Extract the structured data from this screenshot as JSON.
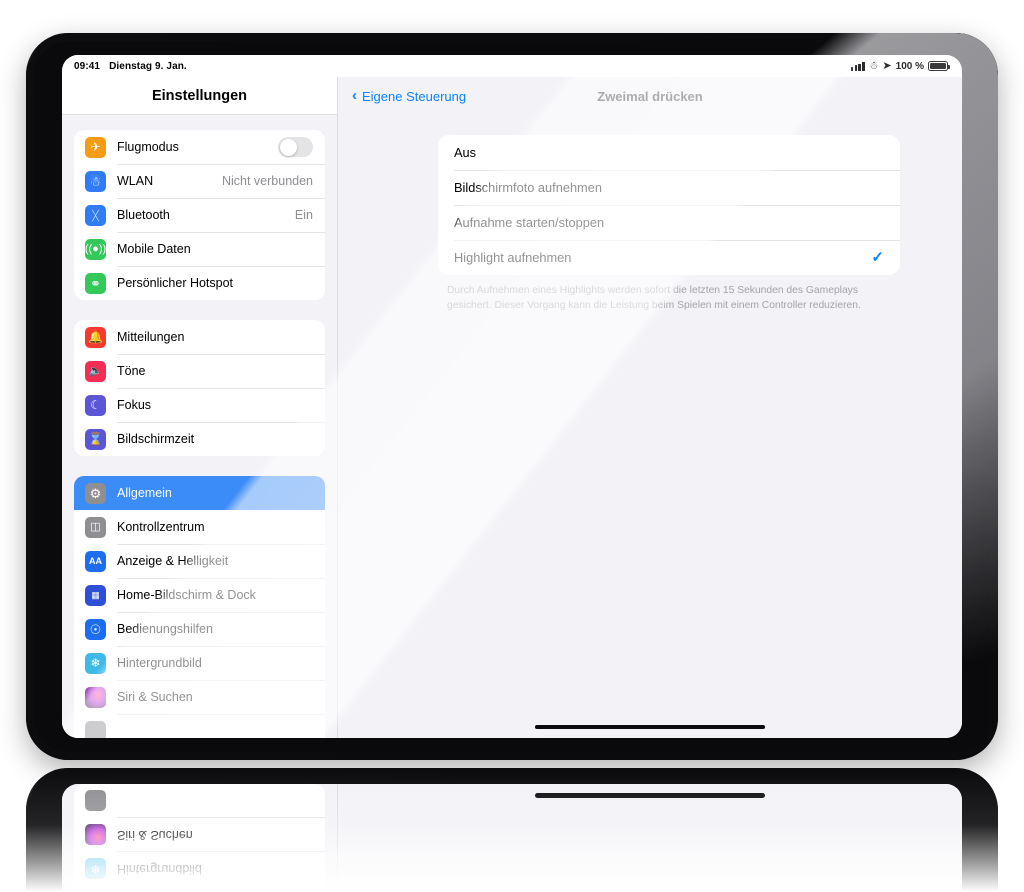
{
  "status_bar": {
    "time": "09:41",
    "date": "Dienstag 9. Jan.",
    "battery_percent": "100 %",
    "icons": [
      "cellular-signal-icon",
      "wifi-icon",
      "location-arrow-icon",
      "battery-icon"
    ]
  },
  "sidebar": {
    "title": "Einstellungen",
    "groups": [
      {
        "items": [
          {
            "label": "Flugmodus",
            "icon": "airplane-icon",
            "icon_color": "#f59b14",
            "control": "toggle",
            "toggle_on": false
          },
          {
            "label": "WLAN",
            "icon": "wifi-icon",
            "icon_color": "#2f7cf6",
            "value": "Nicht verbunden"
          },
          {
            "label": "Bluetooth",
            "icon": "bluetooth-icon",
            "icon_color": "#2f7cf6",
            "value": "Ein"
          },
          {
            "label": "Mobile Daten",
            "icon": "cellular-icon",
            "icon_color": "#34c759"
          },
          {
            "label": "Persönlicher Hotspot",
            "icon": "hotspot-icon",
            "icon_color": "#34c759"
          }
        ]
      },
      {
        "items": [
          {
            "label": "Mitteilungen",
            "icon": "bell-icon",
            "icon_color": "#f6392f"
          },
          {
            "label": "Töne",
            "icon": "speaker-icon",
            "icon_color": "#f52d55"
          },
          {
            "label": "Fokus",
            "icon": "moon-icon",
            "icon_color": "#5a56d6"
          },
          {
            "label": "Bildschirmzeit",
            "icon": "hourglass-icon",
            "icon_color": "#5a56d6"
          }
        ]
      },
      {
        "items": [
          {
            "label": "Allgemein",
            "icon": "gear-icon",
            "icon_color": "#8e8e93",
            "selected": true
          },
          {
            "label": "Kontrollzentrum",
            "icon": "sliders-icon",
            "icon_color": "#8e8e93"
          },
          {
            "label": "Anzeige & Helligkeit",
            "icon": "text-size-icon",
            "icon_color": "#1d6df0"
          },
          {
            "label": "Home-Bildschirm & Dock",
            "icon": "app-grid-icon",
            "icon_color": "#2f4fd6"
          },
          {
            "label": "Bedienungshilfen",
            "icon": "accessibility-icon",
            "icon_color": "#1d6df0"
          },
          {
            "label": "Hintergrundbild",
            "icon": "wallpaper-icon",
            "icon_color": "#3fb9e8"
          },
          {
            "label": "Siri & Suchen",
            "icon": "siri-icon",
            "icon_color": "#241a2e"
          }
        ]
      }
    ]
  },
  "content": {
    "back_label": "Eigene Steuerung",
    "title": "Zweimal drücken",
    "options": [
      {
        "label": "Aus",
        "checked": false
      },
      {
        "label": "Bildschirmfoto aufnehmen",
        "checked": false
      },
      {
        "label": "Aufnahme starten/stoppen",
        "checked": false
      },
      {
        "label": "Highlight aufnehmen",
        "checked": true
      }
    ],
    "footnote": "Durch Aufnehmen eines Highlights werden sofort die letzten 15 Sekunden des Gameplays gesichert. Dieser Vorgang kann die Leistung beim Spielen mit einem Controller reduzieren.",
    "checkmark_glyph": "✓",
    "accent_color": "#0a84ff"
  },
  "reflection": {
    "items": [
      {
        "label": "Siri & Suchen",
        "icon": "siri-icon",
        "icon_color": "#241a2e"
      },
      {
        "label": "Hintergrundbild",
        "icon": "wallpaper-icon",
        "icon_color": "#3fb9e8"
      }
    ]
  }
}
